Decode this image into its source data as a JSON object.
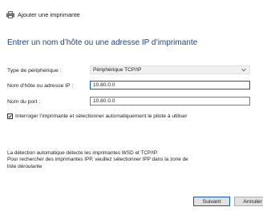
{
  "window": {
    "title": "Ajouter une imprimante"
  },
  "heading": "Entrer un nom d’hôte ou une adresse IP d’imprimante",
  "form": {
    "device_type_label": "Type de périphérique :",
    "device_type_value": "Périphérique TCP/IP",
    "hostname_label": "Nom d’hôte ou adresse IP :",
    "hostname_value": "10.80.0.0",
    "port_label": "Nom du port :",
    "port_value": "10.80.0.0",
    "auto_select_label": "Interroger l’imprimante et sélectionner automatiquement le pilote à utiliser",
    "auto_select_checked": true
  },
  "info": {
    "line1": "La détection automatique détecte les imprimantes WSD et TCP/IP.",
    "line2": "Pour rechercher des imprimantes IPP, veuillez sélectionner IPP dans la zone de",
    "line3": "liste déroulante"
  },
  "buttons": {
    "next_label": "Suivant",
    "cancel_label": "Annuler"
  },
  "colors": {
    "heading": "#1b3f9b",
    "focus_border": "#0a5fb4"
  }
}
